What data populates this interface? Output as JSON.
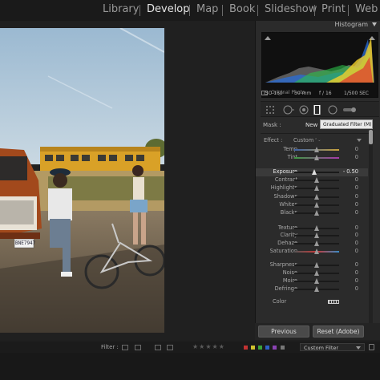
{
  "modules": {
    "items": [
      "Library",
      "Develop",
      "Map",
      "Book",
      "Slideshow",
      "Print",
      "Web"
    ],
    "active": "Develop"
  },
  "histogram": {
    "title": "Histogram",
    "iso": "ISO 160",
    "focal": "50 mm",
    "aperture": "f / 16",
    "shutter": "1/500 SEC",
    "original_photo": "Original Photo"
  },
  "mask": {
    "label": "Mask :",
    "new_label": "New",
    "tooltip": "Graduated Filter (M)"
  },
  "effect": {
    "label": "Effect :",
    "value": "Custom"
  },
  "sliders": [
    {
      "label": "Temp",
      "value": "0",
      "level": 0.5
    },
    {
      "label": "Tint",
      "value": "0",
      "level": 0.5
    },
    {
      "label": "Exposure",
      "value": "- 0.50",
      "level": 0.45,
      "active": true
    },
    {
      "label": "Contrast",
      "value": "0",
      "level": 0.5
    },
    {
      "label": "Highlights",
      "value": "0",
      "level": 0.5
    },
    {
      "label": "Shadows",
      "value": "0",
      "level": 0.5
    },
    {
      "label": "Whites",
      "value": "0",
      "level": 0.5
    },
    {
      "label": "Blacks",
      "value": "0",
      "level": 0.5
    },
    {
      "label": "Texture",
      "value": "0",
      "level": 0.5
    },
    {
      "label": "Clarity",
      "value": "0",
      "level": 0.5
    },
    {
      "label": "Dehaze",
      "value": "0",
      "level": 0.5
    },
    {
      "label": "Saturation",
      "value": "0",
      "level": 0.5
    },
    {
      "label": "Sharpness",
      "value": "0",
      "level": 0.5
    },
    {
      "label": "Noise",
      "value": "0",
      "level": 0.5
    },
    {
      "label": "Moire",
      "value": "0",
      "level": 0.5
    },
    {
      "label": "Defringe",
      "value": "0",
      "level": 0.5
    }
  ],
  "color": {
    "label": "Color"
  },
  "buttons": {
    "previous": "Previous",
    "reset": "Reset (Adobe)"
  },
  "filter_bar": {
    "label": "Filter :",
    "stars": "★★★★★",
    "custom_filter": "Custom Filter"
  },
  "photo": {
    "plate": "BNE7947"
  },
  "colors": {
    "accent_white": "#e6e6e6",
    "panel": "#2b2b2b",
    "sky": "#a9c3d8",
    "bus_yellow": "#e0a92a",
    "truck_orange": "#b5521f"
  }
}
